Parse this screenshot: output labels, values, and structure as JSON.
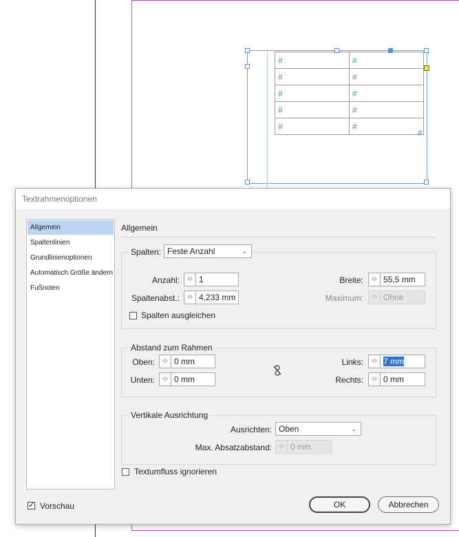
{
  "canvas": {
    "table_cells": [
      [
        "#",
        "#"
      ],
      [
        "#",
        "#"
      ],
      [
        "#",
        "#"
      ],
      [
        "#",
        "#"
      ],
      [
        "#",
        "#"
      ]
    ],
    "overset_marker": "#"
  },
  "dialog": {
    "title": "Textrahmenoptionen",
    "sidebar": {
      "items": [
        {
          "label": "Allgemein",
          "active": true
        },
        {
          "label": "Spaltenlinien",
          "active": false
        },
        {
          "label": "Grundlinienoptionen",
          "active": false
        },
        {
          "label": "Automatisch Größe ändern",
          "active": false
        },
        {
          "label": "Fußnoten",
          "active": false
        }
      ]
    },
    "panel_title": "Allgemein",
    "columns": {
      "legend_label": "Spalten:",
      "mode": "Feste Anzahl",
      "count_label": "Anzahl:",
      "count_value": "1",
      "gutter_label": "Spaltenabst.:",
      "gutter_value": "4,233 mm",
      "width_label": "Breite:",
      "width_value": "55,5 mm",
      "max_label": "Maximum:",
      "max_value": "Ohne",
      "balance_label": "Spalten ausgleichen",
      "balance_checked": false
    },
    "inset": {
      "legend": "Abstand zum Rahmen",
      "top_label": "Oben:",
      "top_value": "0 mm",
      "bottom_label": "Unten:",
      "bottom_value": "0 mm",
      "left_label": "Links:",
      "left_value": "7 mm",
      "right_label": "Rechts:",
      "right_value": "0 mm"
    },
    "vertical": {
      "legend": "Vertikale Ausrichtung",
      "align_label": "Ausrichten:",
      "align_value": "Oben",
      "max_spacing_label": "Max. Absatzabstand:",
      "max_spacing_value": "0 mm"
    },
    "ignore_wrap_label": "Textumfluss ignorieren",
    "ignore_wrap_checked": false,
    "preview_label": "Vorschau",
    "preview_checked": true,
    "ok_label": "OK",
    "cancel_label": "Abbrechen"
  },
  "colors": {
    "frame_blue": "#6aa0dd",
    "page_magenta": "#c44fc4",
    "selection_blue": "#bcd5f0"
  }
}
